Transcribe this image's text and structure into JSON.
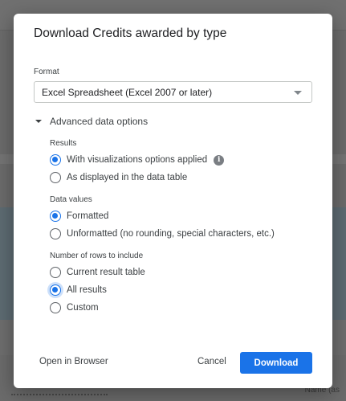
{
  "background": {
    "footer_text": "Name (as"
  },
  "dialog": {
    "title": "Download Credits awarded by type",
    "format": {
      "label": "Format",
      "selected": "Excel Spreadsheet (Excel 2007 or later)"
    },
    "advanced": {
      "label": "Advanced data options"
    },
    "results": {
      "label": "Results",
      "options": [
        {
          "label": "With visualizations options applied",
          "checked": true
        },
        {
          "label": "As displayed in the data table",
          "checked": false
        }
      ]
    },
    "data_values": {
      "label": "Data values",
      "options": [
        {
          "label": "Formatted",
          "checked": true
        },
        {
          "label": "Unformatted (no rounding, special characters, etc.)",
          "checked": false
        }
      ]
    },
    "rows": {
      "label": "Number of rows to include",
      "options": [
        {
          "label": "Current result table",
          "checked": false
        },
        {
          "label": "All results",
          "checked": true
        },
        {
          "label": "Custom",
          "checked": false
        }
      ]
    },
    "buttons": {
      "open_in_browser": "Open in Browser",
      "cancel": "Cancel",
      "download": "Download"
    }
  },
  "colors": {
    "accent": "#1a73e8",
    "overlay": "#6b6b6b"
  },
  "icons": {
    "info": "info-icon",
    "caret": "chevron-down-icon",
    "expand": "triangle-down-icon"
  }
}
